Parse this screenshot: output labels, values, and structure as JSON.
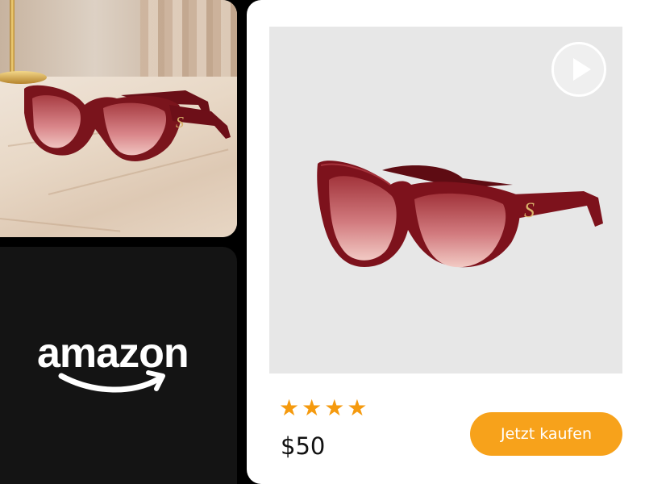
{
  "brand": {
    "logo_text": "amazon",
    "logo_color": "#ffffff",
    "smile_color": "#ffffff"
  },
  "lifestyle_photo": {
    "subject_icon": "cat-eye-sunglasses-icon",
    "frame_color": "#7a141c",
    "lens_color": "#c9676b",
    "temple_letter": "S"
  },
  "product": {
    "image_icon": "cat-eye-sunglasses-icon",
    "frame_color": "#7d121c",
    "lens_color": "#c65f63",
    "temple_letter": "S",
    "image_background": "#e7e7e7"
  },
  "video": {
    "icon": "play-icon"
  },
  "rating": {
    "stars": 4,
    "max_stars": 4,
    "star_glyph": "★",
    "star_color": "#f59a0e"
  },
  "price": "$50",
  "cta": {
    "label": "Jetzt kaufen",
    "color": "#f7a21b"
  }
}
